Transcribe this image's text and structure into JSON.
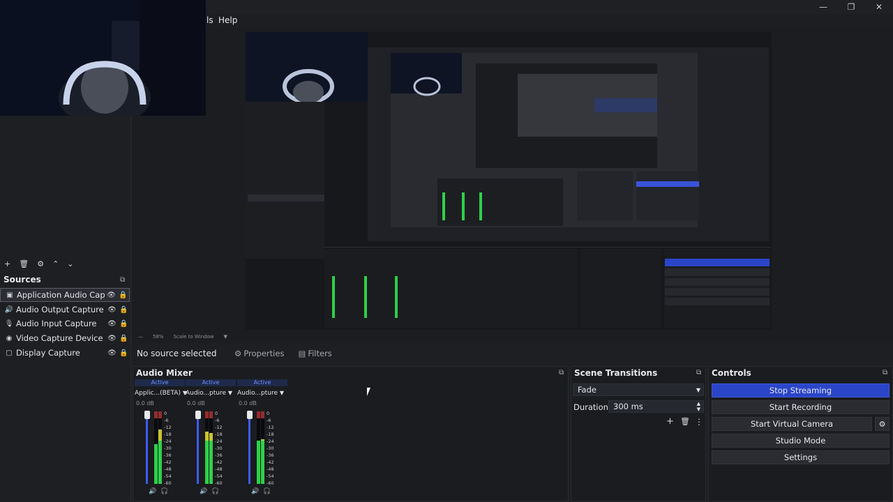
{
  "window": {
    "minimize_glyph": "—",
    "maximize_glyph": "❐",
    "close_glyph": "✕"
  },
  "menu": {
    "tools_partial": "ls",
    "help": "Help"
  },
  "sources": {
    "toolbar": {
      "add": "+",
      "remove": "🗑",
      "properties": "⚙",
      "up": "⌃",
      "down": "⌄"
    },
    "title": "Sources",
    "items": [
      {
        "icon": "application-icon",
        "glyph": "▣",
        "label": "Application Audio Captu",
        "selected": true
      },
      {
        "icon": "speaker-icon",
        "glyph": "🔊",
        "label": "Audio Output Capture",
        "selected": false
      },
      {
        "icon": "microphone-icon",
        "glyph": "🎙",
        "label": "Audio Input Capture",
        "selected": false
      },
      {
        "icon": "camera-icon",
        "glyph": "◉",
        "label": "Video Capture Device",
        "selected": false
      },
      {
        "icon": "monitor-icon",
        "glyph": "▢",
        "label": "Display Capture",
        "selected": false
      }
    ]
  },
  "preview_status": {
    "zoom": "58%",
    "scale_mode": "Scale to Window"
  },
  "context_bar": {
    "no_source": "No source selected",
    "properties": "Properties",
    "filters": "Filters"
  },
  "audio_mixer": {
    "title": "Audio Mixer",
    "scale_labels": [
      "0",
      "-6",
      "-12",
      "-18",
      "-24",
      "-30",
      "-36",
      "-42",
      "-48",
      "-54",
      "-60"
    ],
    "channels": [
      {
        "status": "Active",
        "name": "Applic...(BETA)",
        "db": "0.0 dB",
        "level_left": 0.55,
        "level_right": 0.75
      },
      {
        "status": "Active",
        "name": "Audio...pture",
        "db": "0.0 dB",
        "level_left": 0.72,
        "level_right": 0.7
      },
      {
        "status": "Active",
        "name": "Audio...pture",
        "db": "0.0 dB",
        "level_left": 0.6,
        "level_right": 0.62
      }
    ]
  },
  "scene_transitions": {
    "title": "Scene Transitions",
    "transition": "Fade",
    "duration_label": "Duration",
    "duration_value": "300 ms"
  },
  "controls": {
    "title": "Controls",
    "buttons": [
      {
        "label": "Stop Streaming",
        "primary": true
      },
      {
        "label": "Start Recording",
        "primary": false
      },
      {
        "label": "Start Virtual Camera",
        "primary": false
      },
      {
        "label": "Studio Mode",
        "primary": false
      },
      {
        "label": "Settings",
        "primary": false
      }
    ]
  },
  "colors": {
    "accent": "#2b45c9",
    "meter_green": "#2fd04a",
    "meter_yellow": "#c8c431",
    "meter_red": "#d23a3a"
  }
}
